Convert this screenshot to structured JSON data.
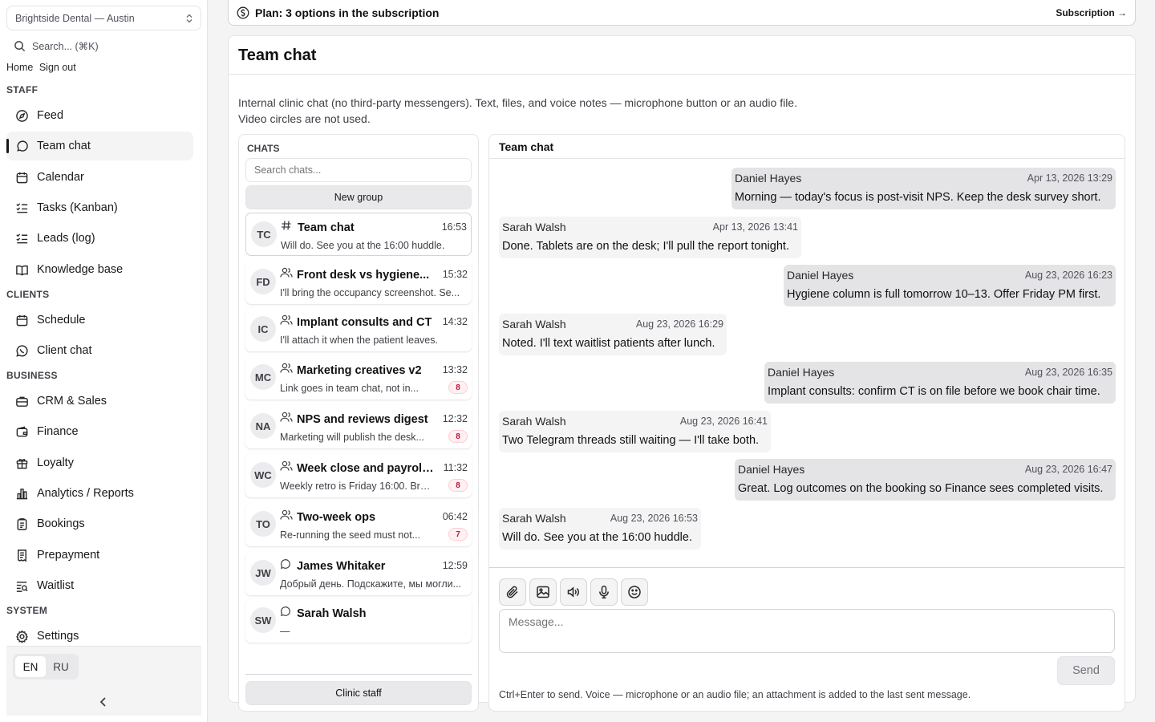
{
  "sidebar": {
    "clinic": "Brightside Dental — Austin",
    "search_placeholder": "Search... (⌘K)",
    "home_link": "Home",
    "signout_link": "Sign out",
    "sections": {
      "staff": "STAFF",
      "clients": "CLIENTS",
      "business": "BUSINESS",
      "system": "SYSTEM"
    },
    "items": [
      {
        "label": "Feed",
        "icon": "compass-icon"
      },
      {
        "label": "Team chat",
        "icon": "chat-bubble-icon",
        "active": true
      },
      {
        "label": "Calendar",
        "icon": "calendar-icon"
      },
      {
        "label": "Tasks (Kanban)",
        "icon": "checklist-icon"
      },
      {
        "label": "Leads (log)",
        "icon": "checklist-icon"
      },
      {
        "label": "Knowledge base",
        "icon": "book-icon"
      },
      {
        "label": "Schedule",
        "icon": "calendar-icon"
      },
      {
        "label": "Client chat",
        "icon": "whatsapp-icon"
      },
      {
        "label": "CRM & Sales",
        "icon": "briefcase-icon"
      },
      {
        "label": "Finance",
        "icon": "wallet-icon"
      },
      {
        "label": "Loyalty",
        "icon": "gift-icon"
      },
      {
        "label": "Analytics / Reports",
        "icon": "bar-chart-icon"
      },
      {
        "label": "Bookings",
        "icon": "clipboard-icon"
      },
      {
        "label": "Prepayment",
        "icon": "receipt-icon"
      },
      {
        "label": "Waitlist",
        "icon": "list-search-icon"
      },
      {
        "label": "Settings",
        "icon": "gear-icon"
      }
    ],
    "languages": [
      "EN",
      "RU"
    ],
    "active_language": "EN"
  },
  "plan": {
    "text": "Plan: 3 options in the subscription",
    "link": "Subscription →"
  },
  "panel": {
    "title": "Team chat",
    "description": "Internal clinic chat (no third-party messengers). Text, files, and voice notes — microphone button or an audio file. Video circles are not used."
  },
  "chats": {
    "label": "CHATS",
    "search_placeholder": "Search chats...",
    "new_group": "New group",
    "clinic_staff": "Clinic staff",
    "list": [
      {
        "initials": "TC",
        "type": "channel",
        "name": "Team chat",
        "time": "16:53",
        "preview": "Will do. See you at the 16:00 huddle.",
        "badge": ""
      },
      {
        "initials": "FD",
        "type": "group",
        "name": "Front desk vs hygiene...",
        "time": "15:32",
        "preview": "I'll bring the occupancy screenshot. Se...",
        "badge": ""
      },
      {
        "initials": "IC",
        "type": "group",
        "name": "Implant consults and CT",
        "time": "14:32",
        "preview": "I'll attach it when the patient leaves.",
        "badge": ""
      },
      {
        "initials": "MC",
        "type": "group",
        "name": "Marketing creatives v2",
        "time": "13:32",
        "preview": "Link goes in team chat, not in...",
        "badge": "8"
      },
      {
        "initials": "NA",
        "type": "group",
        "name": "NPS and reviews digest",
        "time": "12:32",
        "preview": "Marketing will publish the desk...",
        "badge": "8"
      },
      {
        "initials": "WC",
        "type": "group",
        "name": "Week close and payroll...",
        "time": "11:32",
        "preview": "Weekly retro is Friday 16:00. Brin...",
        "badge": "8"
      },
      {
        "initials": "TO",
        "type": "group",
        "name": "Two-week ops",
        "time": "06:42",
        "preview": "Re-running the seed must not...",
        "badge": "7"
      },
      {
        "initials": "JW",
        "type": "direct",
        "name": "James Whitaker",
        "time": "12:59",
        "preview": "Добрый день. Подскажите, мы могли...",
        "badge": ""
      },
      {
        "initials": "SW",
        "type": "direct",
        "name": "Sarah Walsh",
        "time": "",
        "preview": "—",
        "badge": ""
      }
    ]
  },
  "conversation": {
    "title": "Team chat",
    "messages": [
      {
        "author": "Daniel Hayes",
        "time": "Apr 13, 2026 13:29",
        "text": "Morning — today's focus is post-visit NPS. Keep the desk survey short.",
        "outgoing": true
      },
      {
        "author": "Sarah Walsh",
        "time": "Apr 13, 2026 13:41",
        "text": "Done. Tablets are on the desk; I'll pull the report tonight.",
        "outgoing": false
      },
      {
        "author": "Daniel Hayes",
        "time": "Aug 23, 2026 16:23",
        "text": "Hygiene column is full tomorrow 10–13. Offer Friday PM first.",
        "outgoing": true
      },
      {
        "author": "Sarah Walsh",
        "time": "Aug 23, 2026 16:29",
        "text": "Noted. I'll text waitlist patients after lunch.",
        "outgoing": false
      },
      {
        "author": "Daniel Hayes",
        "time": "Aug 23, 2026 16:35",
        "text": "Implant consults: confirm CT is on file before we book chair time.",
        "outgoing": true
      },
      {
        "author": "Sarah Walsh",
        "time": "Aug 23, 2026 16:41",
        "text": "Two Telegram threads still waiting — I'll take both.",
        "outgoing": false
      },
      {
        "author": "Daniel Hayes",
        "time": "Aug 23, 2026 16:47",
        "text": "Great. Log outcomes on the booking so Finance sees completed visits.",
        "outgoing": true
      },
      {
        "author": "Sarah Walsh",
        "time": "Aug 23, 2026 16:53",
        "text": "Will do. See you at the 16:00 huddle.",
        "outgoing": false
      }
    ],
    "tools": [
      "paperclip-icon",
      "image-icon",
      "audio-file-icon",
      "microphone-icon",
      "emoji-icon"
    ],
    "input_placeholder": "Message...",
    "send_label": "Send",
    "hint": "Ctrl+Enter to send. Voice — microphone or an audio file; an attachment is added to the last sent message."
  }
}
